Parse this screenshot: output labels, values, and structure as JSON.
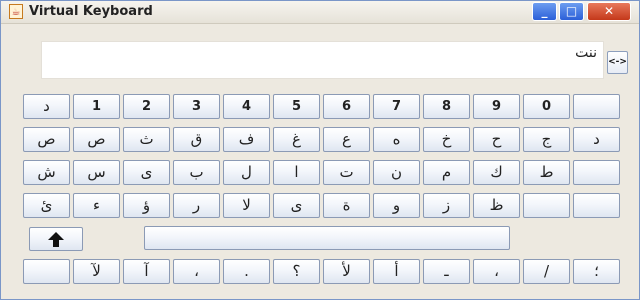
{
  "window": {
    "title": "Virtual Keyboard",
    "icon": "java-icon",
    "controls": {
      "minimize": "minimize-icon",
      "maximize": "maximize-icon",
      "close": "close-icon"
    }
  },
  "display": {
    "text": "ننت",
    "swap_label": "<->"
  },
  "rows": [
    [
      "د",
      "1",
      "2",
      "3",
      "4",
      "5",
      "6",
      "7",
      "8",
      "9",
      "0",
      ""
    ],
    [
      "ص",
      "ص",
      "ث",
      "ق",
      "ف",
      "غ",
      "ع",
      "ه",
      "خ",
      "ح",
      "ج",
      "د"
    ],
    [
      "ش",
      "س",
      "ى",
      "ب",
      "ل",
      "ا",
      "ت",
      "ن",
      "م",
      "ك",
      "ط",
      ""
    ],
    [
      "ئ",
      "ء",
      "ؤ",
      "ر",
      "لا",
      "ى",
      "ة",
      "و",
      "ز",
      "ظ",
      "",
      ""
    ],
    [
      "",
      "لآ",
      "آ",
      "،",
      ".",
      "؟",
      "لأ",
      "أ",
      "ـ",
      "،",
      "/",
      "؛"
    ]
  ],
  "shift": {
    "icon": "shift-arrow-icon"
  },
  "space": {
    "label": ""
  },
  "colors": {
    "accent": "#2b5fd8",
    "close": "#c4381a",
    "key_border": "#8b9ab5"
  }
}
